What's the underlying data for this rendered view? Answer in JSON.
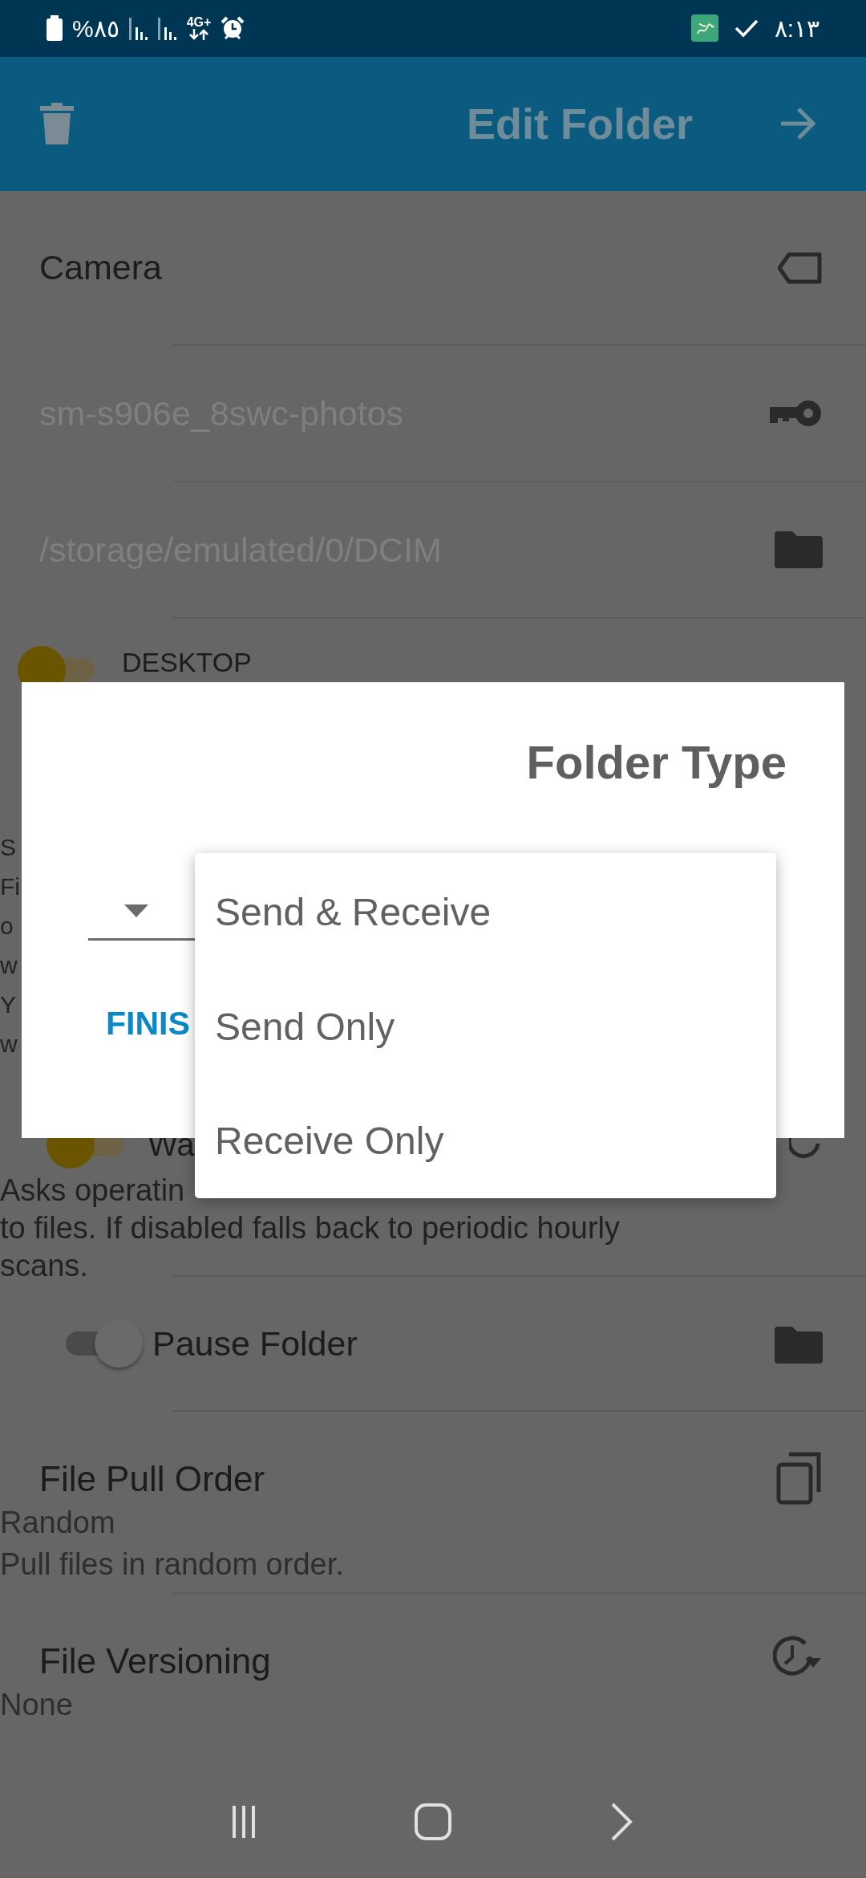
{
  "status_bar": {
    "battery": "%٨٥",
    "network": "4G+",
    "time": "٨:١٣"
  },
  "app_bar": {
    "title": "Edit Folder"
  },
  "settings": [
    {
      "kind": "field",
      "text": "Camera",
      "disabled": false
    },
    {
      "kind": "field",
      "text": "sm-s906e_8swc-photos",
      "disabled": true
    },
    {
      "kind": "field",
      "text": "/storage/emulated/0/DCIM",
      "disabled": true
    },
    {
      "kind": "device",
      "label": "DESKTOP",
      "on": true
    },
    {
      "kind": "fragments",
      "lines": [
        "S",
        "Fi",
        "o",
        "w",
        "Y",
        "w"
      ]
    },
    {
      "kind": "toggle",
      "label": "Wa",
      "on": true,
      "description_lines": [
        "Asks operatin",
        "to files. If disabled falls back to periodic hourly",
        "scans."
      ]
    },
    {
      "kind": "toggle",
      "label": "Pause Folder",
      "on": false
    },
    {
      "kind": "option",
      "title": "File Pull Order",
      "value": "Random",
      "description": "Pull files in random order."
    },
    {
      "kind": "option",
      "title": "File Versioning",
      "value": "None"
    }
  ],
  "dialog": {
    "title": "Folder Type",
    "button": "FINIS",
    "menu": [
      "Send & Receive",
      "Send Only",
      "Receive Only"
    ]
  }
}
